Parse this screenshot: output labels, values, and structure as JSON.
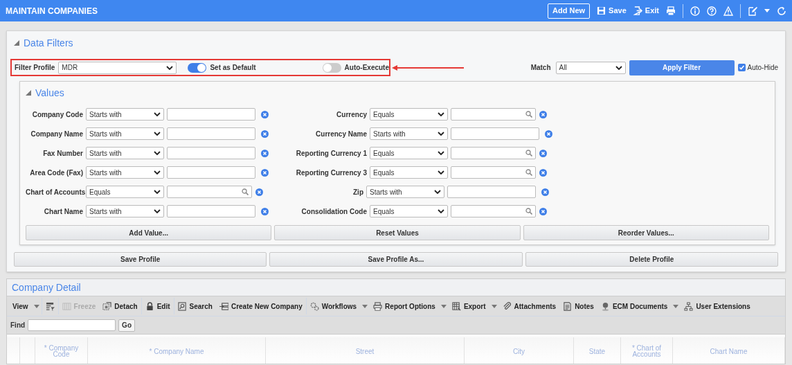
{
  "header": {
    "title": "MAINTAIN COMPANIES",
    "actions": [
      {
        "kind": "outlined",
        "label": "Add New",
        "separator_after": false
      },
      {
        "kind": "save",
        "label": "Save",
        "separator_after": false
      },
      {
        "kind": "exit",
        "label": "Exit",
        "separator_after": false
      },
      {
        "kind": "print",
        "separator_after": true
      },
      {
        "kind": "info",
        "separator_after": false
      },
      {
        "kind": "help",
        "separator_after": false
      },
      {
        "kind": "warning",
        "separator_after": true
      },
      {
        "kind": "edit",
        "separator_after": false
      },
      {
        "kind": "caret",
        "separator_after": false
      },
      {
        "kind": "refresh",
        "separator_after": false
      }
    ]
  },
  "data_filters": {
    "title": "Data Filters",
    "expanded": true,
    "filter_profile": {
      "label": "Filter Profile",
      "value": "MDR"
    },
    "toggles": [
      {
        "label": "Set as Default",
        "on": true
      },
      {
        "label": "Auto-Execute",
        "on": false
      }
    ],
    "match": {
      "label": "Match",
      "value": "All"
    },
    "apply_button": "Apply Filter",
    "auto_hide": {
      "label": "Auto-Hide",
      "checked": true
    },
    "values": {
      "title": "Values",
      "expanded": true,
      "rows": [
        [
          {
            "label": "Company Code",
            "operator": "Starts with",
            "kind": "text"
          },
          {
            "label": "Currency",
            "operator": "Equals",
            "kind": "lookup"
          }
        ],
        [
          {
            "label": "Company Name",
            "operator": "Starts with",
            "kind": "text"
          },
          {
            "label": "Currency Name",
            "operator": "Starts with",
            "kind": "text"
          }
        ],
        [
          {
            "label": "Fax Number",
            "operator": "Starts with",
            "kind": "text"
          },
          {
            "label": "Reporting Currency 1",
            "operator": "Equals",
            "kind": "lookup"
          }
        ],
        [
          {
            "label": "Area Code (Fax)",
            "operator": "Starts with",
            "kind": "text"
          },
          {
            "label": "Reporting Currency 3",
            "operator": "Equals",
            "kind": "lookup"
          }
        ],
        [
          {
            "label": "Chart of Accounts",
            "operator": "Equals",
            "kind": "lookup"
          },
          {
            "label": "Zip",
            "operator": "Starts with",
            "kind": "text"
          }
        ],
        [
          {
            "label": "Chart Name",
            "operator": "Starts with",
            "kind": "text"
          },
          {
            "label": "Consolidation Code",
            "operator": "Equals",
            "kind": "lookup"
          }
        ]
      ],
      "buttons": [
        "Add Value...",
        "Reset Values",
        "Reorder Values..."
      ]
    },
    "profile_buttons": [
      "Save Profile",
      "Save Profile As...",
      "Delete Profile"
    ]
  },
  "company_detail": {
    "title": "Company Detail",
    "toolbar": [
      {
        "kind": "view",
        "label": "View",
        "caret": true,
        "disabled": false,
        "separator_after": true
      },
      {
        "kind": "column-chooser",
        "caret": false,
        "disabled": false,
        "separator_after": true
      },
      {
        "kind": "freeze",
        "label": "Freeze",
        "caret": false,
        "disabled": true,
        "separator_after": false
      },
      {
        "kind": "detach",
        "label": "Detach",
        "caret": false,
        "disabled": false,
        "separator_after": true
      },
      {
        "kind": "edit",
        "label": "Edit",
        "caret": false,
        "disabled": false,
        "separator_after": true
      },
      {
        "kind": "search",
        "label": "Search",
        "caret": false,
        "disabled": false,
        "separator_after": false
      },
      {
        "kind": "create",
        "label": "Create New Company",
        "caret": false,
        "disabled": false,
        "separator_after": true
      },
      {
        "kind": "workflows",
        "label": "Workflows",
        "caret": true,
        "disabled": false,
        "separator_after": false
      },
      {
        "kind": "report",
        "label": "Report Options",
        "caret": true,
        "disabled": false,
        "separator_after": false
      },
      {
        "kind": "export",
        "label": "Export",
        "caret": true,
        "disabled": false,
        "separator_after": false
      },
      {
        "kind": "attachments",
        "label": "Attachments",
        "caret": false,
        "disabled": false,
        "separator_after": false
      },
      {
        "kind": "notes",
        "label": "Notes",
        "caret": false,
        "disabled": false,
        "separator_after": false
      },
      {
        "kind": "ecm",
        "label": "ECM Documents",
        "caret": true,
        "disabled": false,
        "separator_after": false
      },
      {
        "kind": "extensions",
        "label": "User Extensions",
        "caret": false,
        "disabled": false,
        "separator_after": false
      }
    ],
    "find": {
      "label": "Find",
      "button": "Go"
    },
    "columns": [
      "* Company Code",
      "* Company Name",
      "Street",
      "City",
      "State",
      "* Chart of Accounts",
      "Chart Name"
    ]
  }
}
